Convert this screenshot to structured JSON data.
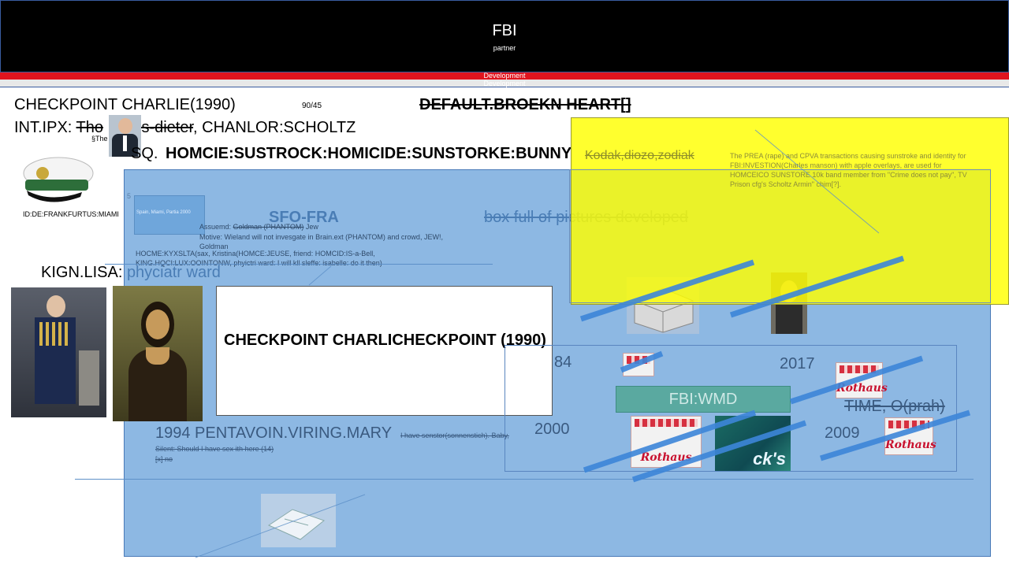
{
  "header": {
    "title": "FBI",
    "subtitle": "partner",
    "band_text": "Development",
    "band_text_2": "Development"
  },
  "top_texts": {
    "checkpoint": "CHECKPOINT CHARLIE(1990)",
    "ratio": "90/45",
    "default": "DEFAULT.BROEKN HEART[]",
    "intipx_prefix": "INT.IPX: ",
    "intipx_struck1": "Tho",
    "intipx_struck2": "is-dieter",
    "intipx_suffix": ", CHANLOR:SCHOLTZ",
    "small_the": "§The",
    "sq_prefix": "SQ.",
    "homicide": "HOMCIE:SUSTROCK:HOMICIDE:SUNSTORKE:BUNNY",
    "id_label": "ID:DE:FRANKFURTUS:MIAMI"
  },
  "yellow_note": {
    "heading": "Kodak,diozo,zodiak",
    "body": "The PREA (rape) and CPVA transactions causing sunstroke and identity for FBI:INVESTION(Charles manson) with apple overlays, are used for HOMCEICO SUNSTORE 10k band member from \"Crime does not pay\", TV Prison cfg's Scholtz Armin\" chim[?]."
  },
  "blue_area": {
    "small_num": "5",
    "thumb_caption": "Spain, Miami, Partia 2000",
    "sfo": "SFO-FRA",
    "box_full": "box full of pictures developed",
    "assumed_prefix": "Assuemd: ",
    "assumed_struck": "Goldman (PHANTOM)",
    "assumed_suffix": " Jew",
    "motive": "Motive: Wieland will not invesgate in Brain.ext (PHANTOM) and crowd, JEW!, Goldman",
    "hocme1": "HOCME:KYXSLTA(sax, Kristina(HOMCE:JEUSE, friend: HOMCID:IS-a-Bell,",
    "hocme2": "KING.HQCI:LUX:OOINTONW, phyictri ward: I will kll sleffe: isabelle: do it then)",
    "kign_prefix": "KIGN.LISA: ",
    "kign_suffix": "phyciatr ward",
    "whitebox_text": "CHECKPOINT CHARLICHECKPOINT (1990)",
    "year_1984": "84",
    "year_2017": "2017",
    "year_2000": "2000",
    "year_2009": "2009",
    "wmd": "FBI:WMD",
    "time": "TIME, O(prah)",
    "pentavoin": "1994 PENTAVOIN.VIRING.MARY",
    "pentavoin_small": "I have senstor(sonnenstich). Baby,",
    "silent": "Silent: Should I have sex ith here (14)",
    "answer": "[x] no",
    "crate_label": "Rothaus",
    "can_label": "ck's"
  },
  "colors": {
    "header_bg": "#000000",
    "red_band": "#e0141e",
    "blue_panel": "#8db8e3",
    "yellow_note": "#ffff00",
    "accent_lines": "#3d86d9",
    "wmd_box": "#5aa9a0"
  }
}
